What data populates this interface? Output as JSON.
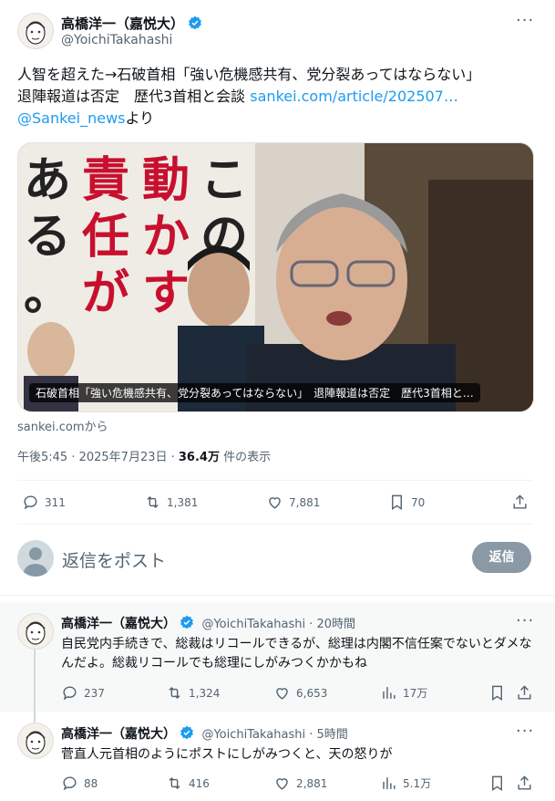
{
  "main_tweet": {
    "author_name": "高橋洋一（嘉悦大）",
    "handle": "@YoichiTakahashi",
    "text_line1": "人智を超えた→石破首相「強い危機感共有、党分裂あってはならない」",
    "text_line2_prefix": "退陣報道は否定　歴代3首相と会談 ",
    "text_link": "sankei.com/article/202507…",
    "mention": "@Sankei_news",
    "mention_suffix": "より",
    "media_poster_text": [
      "責",
      "任",
      "が",
      "動",
      "か",
      "す",
      "こ",
      "の",
      "あ",
      "る",
      "。"
    ],
    "media_caption": "石破首相「強い危機感共有、党分裂あってはならない」　退陣報道は否定　歴代3首相と…",
    "source": "sankei.comから",
    "time": "午後5:45 · 2025年7月23日 · ",
    "views": "36.4万",
    "views_suffix": " 件の表示",
    "actions": {
      "replies": "311",
      "retweets": "1,381",
      "likes": "7,881",
      "bookmarks": "70"
    }
  },
  "composer": {
    "placeholder": "返信をポスト",
    "button": "返信"
  },
  "replies": [
    {
      "author_name": "高橋洋一（嘉悦大）",
      "handle_time": "@YoichiTakahashi · 20時間",
      "text": "自民党内手続きで、総裁はリコールできるが、総理は内閣不信任案でないとダメなんだよ。総裁リコールでも総理にしがみつくかかもね",
      "actions": {
        "replies": "237",
        "retweets": "1,324",
        "likes": "6,653",
        "views": "17万"
      }
    },
    {
      "author_name": "高橋洋一（嘉悦大）",
      "handle_time": "@YoichiTakahashi · 5時間",
      "text": "菅直人元首相のようにポストにしがみつくと、天の怒りが",
      "actions": {
        "replies": "88",
        "retweets": "416",
        "likes": "2,881",
        "views": "5.1万"
      }
    }
  ],
  "colors": {
    "accent": "#1d9bf0",
    "poster_red": "#c8102e",
    "muted": "#536471"
  }
}
